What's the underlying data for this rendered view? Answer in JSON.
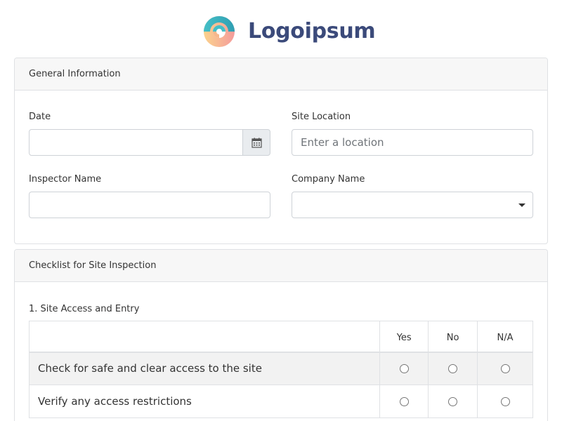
{
  "brand": {
    "name": "Logoipsum",
    "icon": "logoipsum-mark",
    "colors": {
      "teal": "#45bfc7",
      "peach": "#f7b88c",
      "text": "#3b4a7a"
    }
  },
  "general": {
    "header": "General Information",
    "date": {
      "label": "Date",
      "value": "",
      "icon": "calendar-icon"
    },
    "site_location": {
      "label": "Site Location",
      "placeholder": "Enter a location"
    },
    "inspector_name": {
      "label": "Inspector Name",
      "value": ""
    },
    "company_name": {
      "label": "Company Name",
      "selected": ""
    }
  },
  "checklist": {
    "header": "Checklist for Site Inspection",
    "section_title": "1. Site Access and Entry",
    "columns": [
      "",
      "Yes",
      "No",
      "N/A"
    ],
    "rows": [
      {
        "label": "Check for safe and clear access to the site",
        "selected": null
      },
      {
        "label": "Verify any access restrictions",
        "selected": null
      }
    ]
  }
}
